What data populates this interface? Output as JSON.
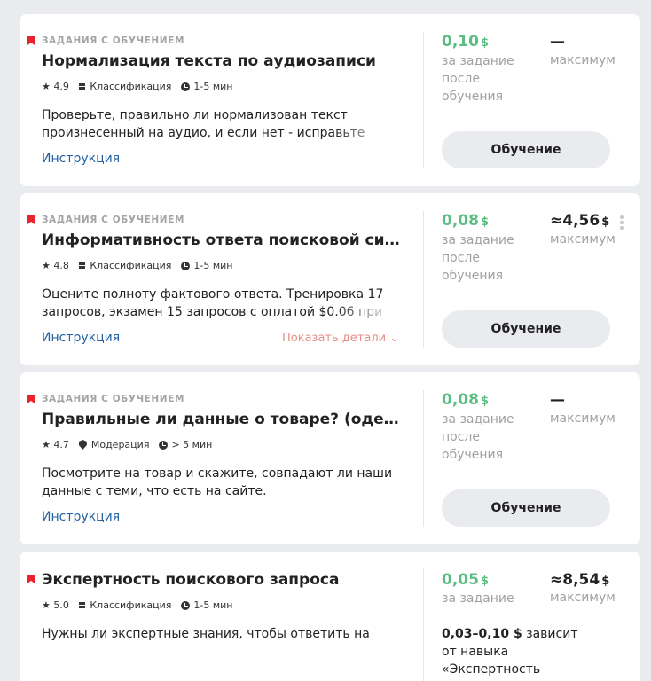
{
  "cards": [
    {
      "tag": "ЗАДАНИЯ С ОБУЧЕНИЕМ",
      "title": "Нормализация текста по аудиозаписи",
      "rating": "★ 4.9",
      "category": "Классификация",
      "duration": "1-5 мин",
      "description": "Проверьте, правильно ли нормализован текст произнесенный на аудио, и если нет - исправьте ошибки.",
      "instruction": "Инструкция",
      "price": "0,10",
      "currency": "$",
      "price_note": "за задание после обучения",
      "max_value": "—",
      "max_label": "максимум",
      "button": "Обучение"
    },
    {
      "tag": "ЗАДАНИЯ С ОБУЧЕНИЕМ",
      "title": "Информативность ответа поисковой системы",
      "rating": "★ 4.8",
      "category": "Классификация",
      "duration": "1-5 мин",
      "description": "Оцените полноту фактового ответа. Тренировка 17 запросов, экзамен 15 запросов с оплатой $0.06 при",
      "instruction": "Инструкция",
      "details": "Показать детали ⌄",
      "price": "0,08",
      "currency": "$",
      "price_note": "за задание после обучения",
      "max_value": "≈4,56",
      "max_label": "максимум",
      "button": "Обучение"
    },
    {
      "tag": "ЗАДАНИЯ С ОБУЧЕНИЕМ",
      "title": "Правильные ли данные о товаре? (одежда)",
      "rating": "★ 4.7",
      "category": "Модерация",
      "duration": "> 5 мин",
      "description": "Посмотрите на товар и скажите, совпадают ли наши данные с теми, что есть на сайте.",
      "instruction": "Инструкция",
      "price": "0,08",
      "currency": "$",
      "price_note": "за задание после обучения",
      "max_value": "—",
      "max_label": "максимум",
      "button": "Обучение"
    },
    {
      "title": "Экспертность поискового запроса",
      "rating": "★ 5.0",
      "category": "Классификация",
      "duration": "1-5 мин",
      "description": "Нужны ли экспертные знания, чтобы ответить на запрос?",
      "price": "0,05",
      "currency": "$",
      "price_note": "за задание",
      "max_value": "≈8,54",
      "max_label": "максимум",
      "range": "0,03–0,10 $",
      "range_note": " зависит от навыка «Экспертность поискового запроса -"
    }
  ]
}
